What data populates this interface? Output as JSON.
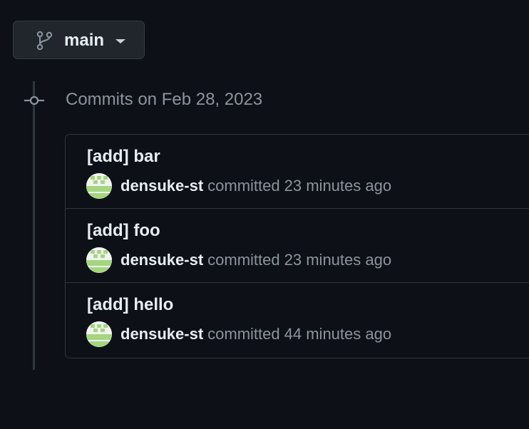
{
  "branch": {
    "name": "main",
    "icon": "git-branch-icon"
  },
  "commit_group": {
    "heading": "Commits on Feb 28, 2023",
    "icon": "git-commit-icon"
  },
  "commits": [
    {
      "title": "[add] bar",
      "author": "densuke-st",
      "action": "committed",
      "time": "23 minutes ago"
    },
    {
      "title": "[add] foo",
      "author": "densuke-st",
      "action": "committed",
      "time": "23 minutes ago"
    },
    {
      "title": "[add] hello",
      "author": "densuke-st",
      "action": "committed",
      "time": "44 minutes ago"
    }
  ],
  "colors": {
    "background": "#0d1117",
    "border": "#30363d",
    "text_primary": "#e6edf3",
    "text_muted": "#8b949e",
    "avatar_green": "#a3d67e"
  }
}
